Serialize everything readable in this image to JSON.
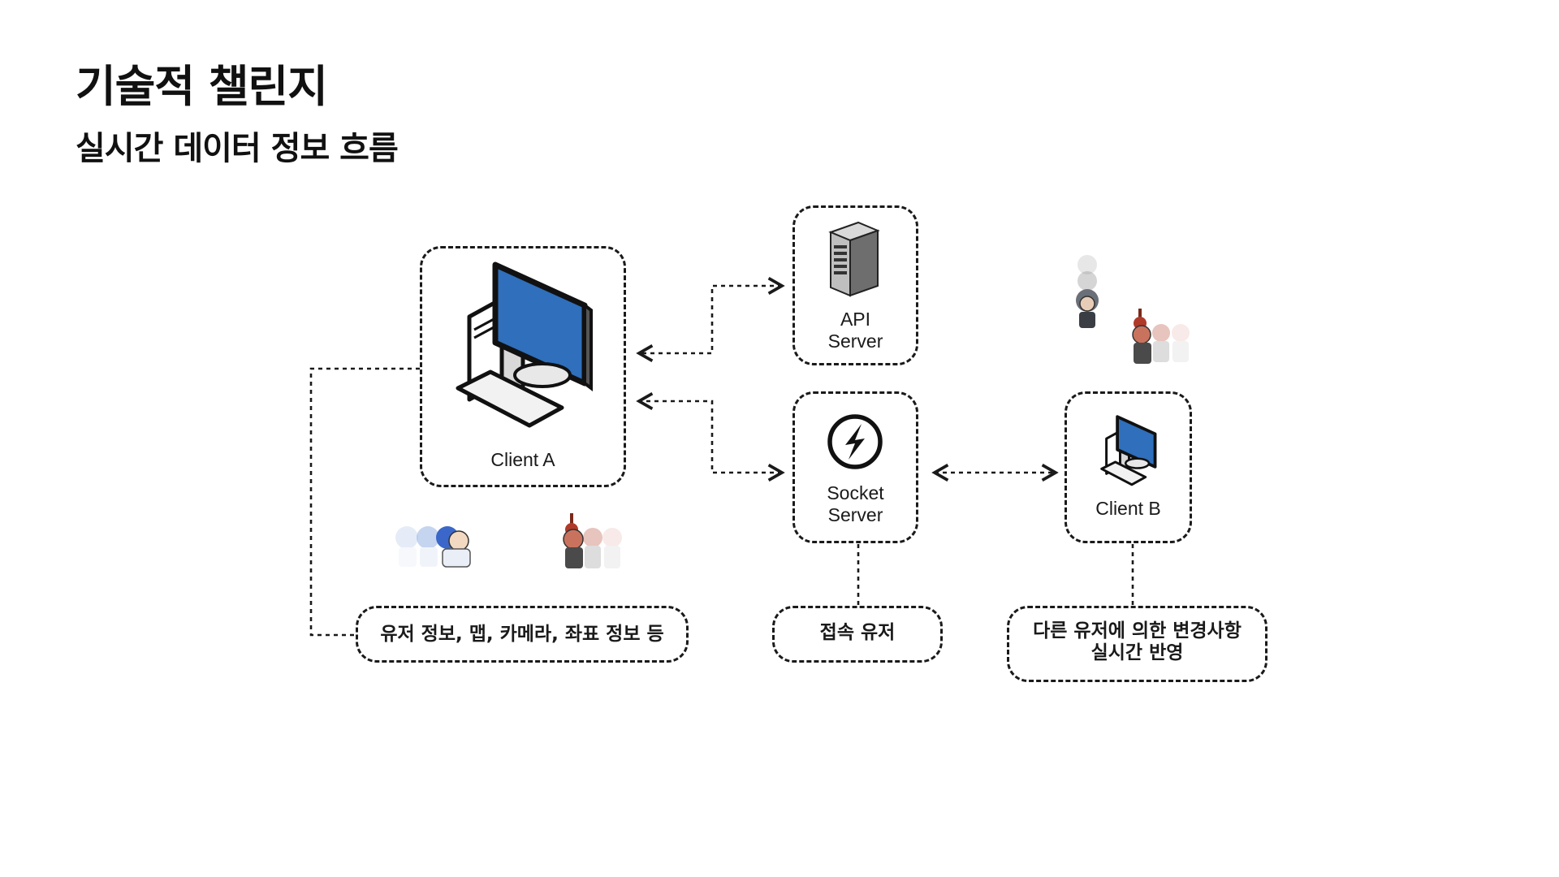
{
  "header": {
    "title": "기술적 챌린지",
    "subtitle": "실시간 데이터 정보 흐름"
  },
  "nodes": {
    "client_a": "Client A",
    "api_server_line1": "API",
    "api_server_line2": "Server",
    "socket_server_line1": "Socket",
    "socket_server_line2": "Server",
    "client_b": "Client B"
  },
  "notes": {
    "client_a_data": "유저 정보, 맵, 카메라, 좌표 정보 등",
    "socket_users": "접속 유저",
    "client_b_line1": "다른 유저에 의한 변경사항",
    "client_b_line2": "실시간 반영"
  },
  "colors": {
    "monitor_blue": "#2f6fbb",
    "dash": "#1a1a1a"
  },
  "icons": [
    "desktop-computer-icon",
    "server-tower-icon",
    "socket-io-icon",
    "character-sprite-icon"
  ]
}
